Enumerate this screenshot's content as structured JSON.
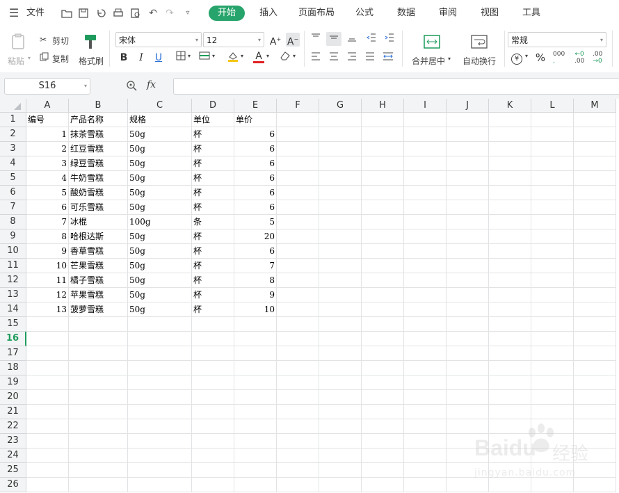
{
  "menu": {
    "hamburger_label": "文件",
    "tabs": [
      "开始",
      "插入",
      "页面布局",
      "公式",
      "数据",
      "审阅",
      "视图",
      "工具"
    ],
    "active_tab": "开始"
  },
  "ribbon": {
    "paste": "粘贴",
    "cut": "剪切",
    "copy": "复制",
    "format_painter": "格式刷",
    "font_name": "宋体",
    "font_size": "12",
    "merge_center": "合并居中",
    "wrap_text": "自动换行",
    "number_format": "常规",
    "currency_symbol": "¥",
    "percent_symbol": "%",
    "thousands": "000",
    "inc_decimal_top": "←0",
    "inc_decimal_bottom": ".00",
    "dec_decimal_top": ".00",
    "dec_decimal_bottom": "→0",
    "bold": "B",
    "italic": "I",
    "underline": "U",
    "font_color_letter": "A",
    "font_color": "#e02020",
    "fill_color": "#f5c518"
  },
  "formula_bar": {
    "name_box": "S16",
    "fx_label": "fx",
    "formula": ""
  },
  "sheet": {
    "columns": [
      "A",
      "B",
      "C",
      "D",
      "E",
      "F",
      "G",
      "H",
      "I",
      "J",
      "K",
      "L",
      "M"
    ],
    "rows": [
      "1",
      "2",
      "3",
      "4",
      "5",
      "6",
      "7",
      "8",
      "9",
      "10",
      "11",
      "12",
      "13",
      "14",
      "15",
      "16",
      "17",
      "18",
      "19",
      "20",
      "21",
      "22",
      "23",
      "24",
      "25",
      "26"
    ],
    "selected_row": "16",
    "header": [
      "编号",
      "产品名称",
      "规格",
      "单位",
      "单价"
    ],
    "data": [
      [
        "1",
        "抹茶雪糕",
        "50g",
        "杯",
        "6"
      ],
      [
        "2",
        "红豆雪糕",
        "50g",
        "杯",
        "6"
      ],
      [
        "3",
        "绿豆雪糕",
        "50g",
        "杯",
        "6"
      ],
      [
        "4",
        "牛奶雪糕",
        "50g",
        "杯",
        "6"
      ],
      [
        "5",
        "酸奶雪糕",
        "50g",
        "杯",
        "6"
      ],
      [
        "6",
        "可乐雪糕",
        "50g",
        "杯",
        "6"
      ],
      [
        "7",
        "冰棍",
        "100g",
        "条",
        "5"
      ],
      [
        "8",
        "哈根达斯",
        "50g",
        "杯",
        "20"
      ],
      [
        "9",
        "香草雪糕",
        "50g",
        "杯",
        "6"
      ],
      [
        "10",
        "芒果雪糕",
        "50g",
        "杯",
        "7"
      ],
      [
        "11",
        "橘子雪糕",
        "50g",
        "杯",
        "8"
      ],
      [
        "12",
        "苹果雪糕",
        "50g",
        "杯",
        "9"
      ],
      [
        "13",
        "菠萝雪糕",
        "50g",
        "杯",
        "10"
      ]
    ]
  },
  "watermark": {
    "brand": "Baidu",
    "cn": "经验",
    "url": "jingyan.baidu.com"
  },
  "colors": {
    "accent": "#27a46b",
    "selected_row": "#1e9b5c"
  }
}
